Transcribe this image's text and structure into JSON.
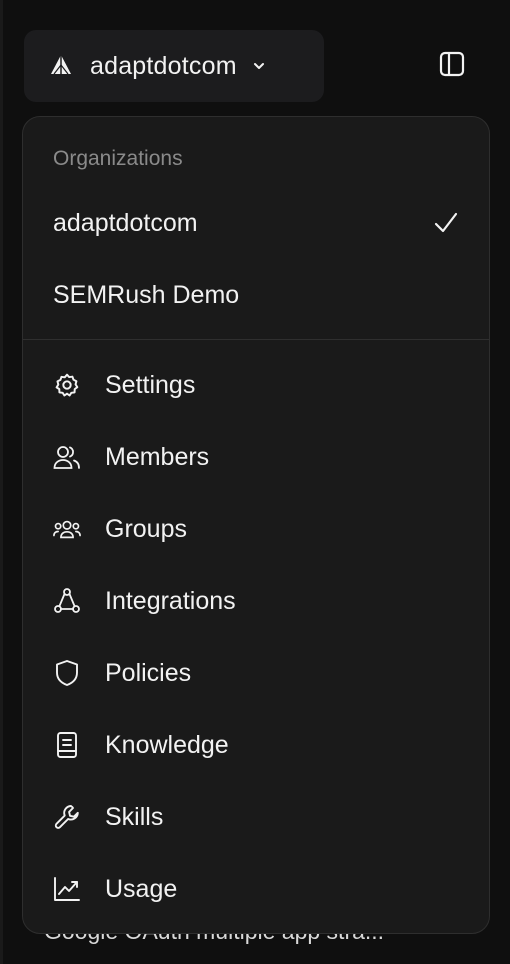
{
  "switcher": {
    "org_name": "adaptdotcom",
    "logo_icon": "org-logo-icon",
    "chevron_icon": "chevron-down-icon"
  },
  "toolbar": {
    "sidebar_toggle_icon": "sidebar-panel-icon"
  },
  "dropdown": {
    "section_label": "Organizations",
    "organizations": [
      {
        "name": "adaptdotcom",
        "selected": true
      },
      {
        "name": "SEMRush Demo",
        "selected": false
      }
    ],
    "menu": [
      {
        "label": "Settings",
        "icon": "gear-icon"
      },
      {
        "label": "Members",
        "icon": "users-icon"
      },
      {
        "label": "Groups",
        "icon": "groups-icon"
      },
      {
        "label": "Integrations",
        "icon": "integrations-icon"
      },
      {
        "label": "Policies",
        "icon": "shield-icon"
      },
      {
        "label": "Knowledge",
        "icon": "book-icon"
      },
      {
        "label": "Skills",
        "icon": "wrench-icon"
      },
      {
        "label": "Usage",
        "icon": "chart-line-icon"
      }
    ]
  },
  "background": {
    "partial_item_text": "Google OAuth multiple app stra..."
  },
  "colors": {
    "background": "#0f0f0f",
    "panel": "#1a1a1a",
    "text": "#f2f2f2",
    "muted": "#8a8a8a"
  }
}
